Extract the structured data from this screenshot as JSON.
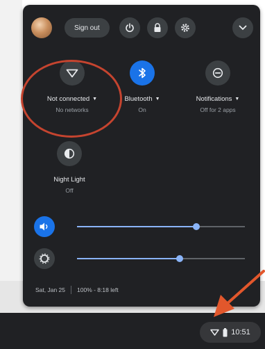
{
  "header": {
    "signout_label": "Sign out",
    "buttons": [
      "power-icon",
      "lock-icon",
      "gear-icon",
      "chevron-down-icon"
    ]
  },
  "tiles": {
    "network": {
      "label": "Not connected",
      "sub": "No networks",
      "icon": "wifi-icon"
    },
    "bluetooth": {
      "label": "Bluetooth",
      "sub": "On",
      "icon": "bluetooth-icon",
      "active": true
    },
    "notifications": {
      "label": "Notifications",
      "sub": "Off for 2 apps",
      "icon": "do-not-disturb-icon"
    },
    "night_light": {
      "label": "Night Light",
      "sub": "Off",
      "icon": "night-light-icon"
    }
  },
  "sliders": {
    "volume": {
      "icon": "volume-icon",
      "level": 0.71
    },
    "brightness": {
      "icon": "brightness-icon",
      "level": 0.61
    }
  },
  "footer": {
    "date": "Sat, Jan 25",
    "battery": "100% - 8:18 left"
  },
  "shelf": {
    "time": "10:51",
    "icons": [
      "wifi-icon",
      "battery-icon"
    ]
  },
  "annotation": {
    "ring_color": "#c5442f",
    "arrow_color": "#e2572c"
  },
  "colors": {
    "panel": "#202124",
    "accent": "#1a73e8",
    "slider": "#8ab4f8"
  }
}
